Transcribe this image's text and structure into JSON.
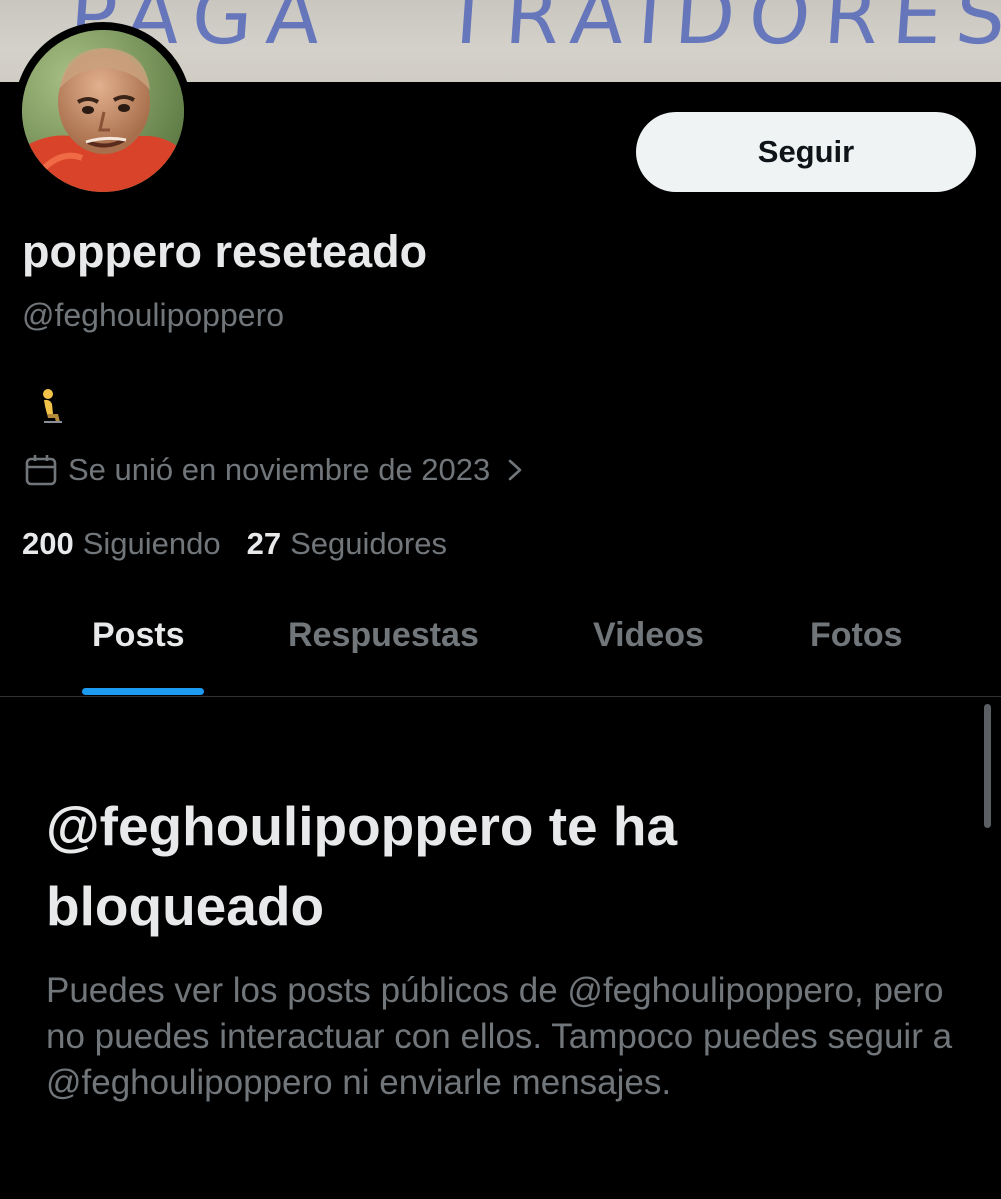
{
  "banner": {
    "text_left": "PAGA",
    "text_right": "TRAIDORES"
  },
  "profile": {
    "avatar_alt": "profile-photo",
    "follow_label": "Seguir",
    "display_name": "poppero reseteado",
    "handle": "@feghoulipoppero",
    "bio_icon": "person-kneeling-emoji",
    "joined_text": "Se unió en noviembre de 2023",
    "following_count": "200",
    "following_label": "Siguiendo",
    "followers_count": "27",
    "followers_label": "Seguidores"
  },
  "tabs": [
    {
      "label": "Posts",
      "active": true
    },
    {
      "label": "Respuestas",
      "active": false
    },
    {
      "label": "Videos",
      "active": false
    },
    {
      "label": "Fotos",
      "active": false
    }
  ],
  "blocked": {
    "title": "@feghoulipoppero te ha bloqueado",
    "description": "Puedes ver los posts públicos de @feghoulipoppero, pero no puedes interactuar con ellos. Tampoco puedes seguir a @feghoulipoppero ni enviarle mensajes."
  },
  "colors": {
    "background": "#000000",
    "text_primary": "#e7e9ea",
    "text_secondary": "#71767b",
    "accent": "#1d9bf0",
    "button_bg": "#eff3f4"
  }
}
